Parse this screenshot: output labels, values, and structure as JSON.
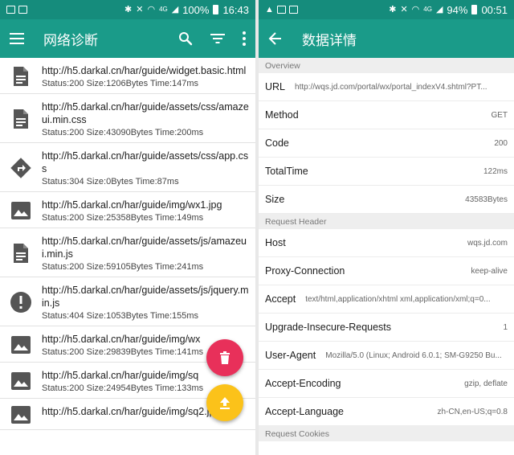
{
  "left": {
    "status_bar": {
      "battery": "100%",
      "time": "16:43",
      "network": "4G"
    },
    "app_bar": {
      "title": "网络诊断"
    },
    "requests": [
      {
        "icon": "document-icon",
        "url": "http://h5.darkal.cn/har/guide/widget.basic.html",
        "meta": "Status:200 Size:1206Bytes Time:147ms"
      },
      {
        "icon": "document-icon",
        "url": "http://h5.darkal.cn/har/guide/assets/css/amazeui.min.css",
        "meta": "Status:200 Size:43090Bytes Time:200ms"
      },
      {
        "icon": "redirect-icon",
        "url": "http://h5.darkal.cn/har/guide/assets/css/app.css",
        "meta": "Status:304 Size:0Bytes Time:87ms"
      },
      {
        "icon": "image-icon",
        "url": "http://h5.darkal.cn/har/guide/img/wx1.jpg",
        "meta": "Status:200 Size:25358Bytes Time:149ms"
      },
      {
        "icon": "document-icon",
        "url": "http://h5.darkal.cn/har/guide/assets/js/amazeui.min.js",
        "meta": "Status:200 Size:59105Bytes Time:241ms"
      },
      {
        "icon": "error-icon",
        "url": "http://h5.darkal.cn/har/guide/assets/js/jquery.min.js",
        "meta": "Status:404 Size:1053Bytes Time:155ms"
      },
      {
        "icon": "image-icon",
        "url": "http://h5.darkal.cn/har/guide/img/wx",
        "meta": "Status:200 Size:29839Bytes Time:141ms"
      },
      {
        "icon": "image-icon",
        "url": "http://h5.darkal.cn/har/guide/img/sq",
        "meta": "Status:200 Size:24954Bytes Time:133ms"
      },
      {
        "icon": "image-icon",
        "url": "http://h5.darkal.cn/har/guide/img/sq2.jpg",
        "meta": ""
      }
    ],
    "colors": {
      "app_bar": "#1a9b89",
      "status_bar": "#158c7c",
      "fab_delete": "#e8305a",
      "fab_upload": "#fbc21a"
    }
  },
  "right": {
    "status_bar": {
      "battery": "94%",
      "time": "00:51",
      "network": "4G"
    },
    "app_bar": {
      "title": "数据详情"
    },
    "sections": [
      {
        "title": "Overview",
        "rows": [
          {
            "key": "URL",
            "value": "http://wqs.jd.com/portal/wx/portal_indexV4.shtml?PT..."
          },
          {
            "key": "Method",
            "value": "GET"
          },
          {
            "key": "Code",
            "value": "200"
          },
          {
            "key": "TotalTime",
            "value": "122ms"
          },
          {
            "key": "Size",
            "value": "43583Bytes"
          }
        ]
      },
      {
        "title": "Request Header",
        "rows": [
          {
            "key": "Host",
            "value": "wqs.jd.com"
          },
          {
            "key": "Proxy-Connection",
            "value": "keep-alive"
          },
          {
            "key": "Accept",
            "value": "text/html,application/xhtml xml,application/xml;q=0..."
          },
          {
            "key": "Upgrade-Insecure-Requests",
            "value": "1"
          },
          {
            "key": "User-Agent",
            "value": "Mozilla/5.0 (Linux; Android 6.0.1; SM-G9250 Bu..."
          },
          {
            "key": "Accept-Encoding",
            "value": "gzip, deflate"
          },
          {
            "key": "Accept-Language",
            "value": "zh-CN,en-US;q=0.8"
          }
        ]
      },
      {
        "title": "Request Cookies",
        "rows": []
      }
    ]
  }
}
